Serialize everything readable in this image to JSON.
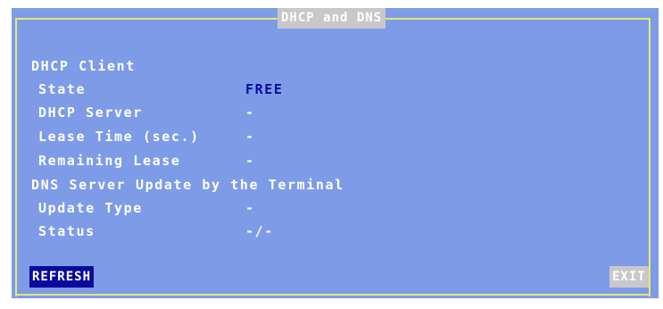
{
  "window": {
    "title": "DHCP and DNS"
  },
  "dhcp_client": {
    "heading": "DHCP Client",
    "state": {
      "label": "State",
      "value": "FREE"
    },
    "dhcp_server": {
      "label": "DHCP Server",
      "value": "-"
    },
    "lease_time": {
      "label": "Lease Time (sec.)",
      "value": "-"
    },
    "remaining_lease": {
      "label": "Remaining Lease",
      "value": "-"
    }
  },
  "dns_update": {
    "heading": "DNS Server Update by the Terminal",
    "update_type": {
      "label": "Update Type",
      "value": "-"
    },
    "status": {
      "label": "Status",
      "value": "-/-"
    }
  },
  "buttons": {
    "refresh": "REFRESH",
    "exit": "EXIT"
  },
  "colors": {
    "background": "#7d9be6",
    "frame": "#e8e870",
    "title_bg": "#c8c8c8",
    "highlight": "#0a0a9c"
  }
}
